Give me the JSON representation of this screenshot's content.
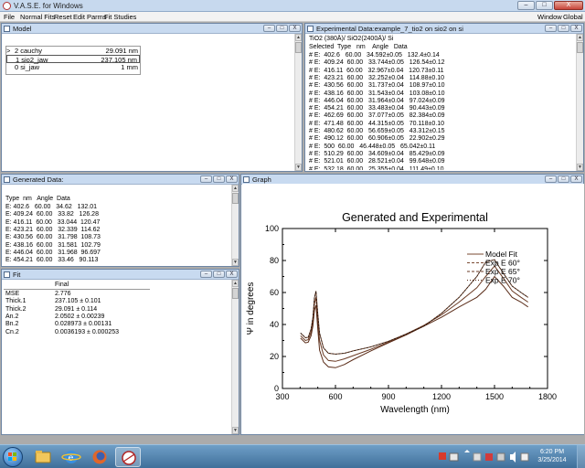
{
  "app": {
    "title": "V.A.S.E. for Windows",
    "window_buttons": {
      "minimize": "–",
      "maximize": "□",
      "close": "X"
    }
  },
  "menu": {
    "left": [
      "File",
      "Normal Fits",
      "Reset",
      "Edit Parms",
      "Fit Studies"
    ],
    "right": [
      "Window",
      "Global"
    ]
  },
  "model_window": {
    "title": "Model",
    "layers": [
      {
        "marker": ">",
        "name": "2 cauchy",
        "value": "29.091 nm",
        "selected": false
      },
      {
        "marker": "",
        "name": "1 sio2_jaw",
        "value": "237.105 nm",
        "selected": true
      },
      {
        "marker": "",
        "name": "0 si_jaw",
        "value": "1 mm",
        "selected": false
      }
    ]
  },
  "exp_window": {
    "title": "Experimental Data:example_7_tio2 on sio2 on si",
    "sample": "TiO2 (380Å)/ SiO2(2400Å)/ Si",
    "header": "Selected  Type   nm    Angle   Data",
    "rows": [
      "# E:  402.6   60.00   34.592±0.05   132.4±0.14",
      "# E:  409.24  60.00   33.744±0.05   126.54±0.12",
      "# E:  416.11  60.00   32.967±0.04   120.73±0.11",
      "# E:  423.21  60.00   32.252±0.04   114.88±0.10",
      "# E:  430.56  60.00   31.737±0.04   108.97±0.10",
      "# E:  438.16  60.00   31.543±0.04   103.08±0.10",
      "# E:  446.04  60.00   31.964±0.04   97.024±0.09",
      "# E:  454.21  60.00   33.483±0.04   90.443±0.09",
      "# E:  462.69  60.00   37.077±0.05   82.384±0.09",
      "# E:  471.48  60.00   44.315±0.05   70.118±0.10",
      "# E:  480.62  60.00   56.659±0.05   43.312±0.15",
      "# E:  490.12  60.00   60.906±0.05   22.902±0.29",
      "# E:  500  60.00   46.448±0.05   65.042±0.11",
      "# E:  510.29  60.00   34.609±0.04   85.429±0.09",
      "# E:  521.01  60.00   28.521±0.04   99.648±0.09",
      "# E:  532.18  60.00   25.355±0.04   111.49±0.10"
    ]
  },
  "gen_window": {
    "title": "Generated Data:",
    "header": "Type  nm   Angle  Data",
    "rows": [
      "E: 402.6   60.00   34.62   132.01",
      "E: 409.24  60.00   33.82   126.28",
      "E: 416.11  60.00   33.044  120.47",
      "E: 423.21  60.00   32.339  114.62",
      "E: 430.56  60.00   31.798  108.73",
      "E: 438.16  60.00   31.581  102.79",
      "E: 446.04  60.00   31.968  96.697",
      "E: 454.21  60.00   33.46   90.113"
    ]
  },
  "fit_window": {
    "title": "Fit",
    "col_header": "Final",
    "rows": [
      {
        "name": "MSE",
        "value": "2.776"
      },
      {
        "name": "Thick.1",
        "value": "237.105 ± 0.101"
      },
      {
        "name": "Thick.2",
        "value": "29.091 ± 0.114"
      },
      {
        "name": "An.2",
        "value": "2.0502 ± 0.00239"
      },
      {
        "name": "Bn.2",
        "value": "0.028973 ± 0.00131"
      },
      {
        "name": "Cn.2",
        "value": "0.0036193 ± 0.000253"
      }
    ]
  },
  "graph_window": {
    "title": "Graph",
    "chart_data": {
      "type": "line",
      "title": "Generated and Experimental",
      "xlabel": "Wavelength (nm)",
      "ylabel": "Ψ in degrees",
      "xlim": [
        300,
        1800
      ],
      "ylim": [
        0,
        100
      ],
      "xticks": [
        300,
        600,
        900,
        1200,
        1500,
        1800
      ],
      "yticks": [
        0,
        20,
        40,
        60,
        80,
        100
      ],
      "grid": false,
      "legend_position": "top-right",
      "legend": [
        "Model Fit",
        "Exp E 60°",
        "Exp E 65°",
        "Exp E 70°"
      ],
      "series": [
        {
          "name": "Exp E 60°",
          "color": "#7a4a32",
          "x": [
            402.6,
            430,
            446,
            462,
            472,
            481,
            490,
            500,
            510,
            532,
            560,
            600,
            650,
            700,
            800,
            900,
            1000,
            1100,
            1200,
            1300,
            1400,
            1450,
            1500,
            1550,
            1600,
            1650,
            1690
          ],
          "y": [
            34.6,
            31.7,
            32.0,
            37.1,
            44.3,
            56.7,
            60.9,
            46.4,
            34.6,
            25.4,
            22.0,
            21.5,
            22.0,
            23.5,
            26.0,
            29.5,
            34.0,
            39.0,
            47.0,
            57.0,
            70.0,
            79.0,
            80.5,
            72.0,
            64.0,
            60.0,
            57.0
          ]
        },
        {
          "name": "Exp E 65°",
          "color": "#6a3a24",
          "x": [
            402.6,
            430,
            446,
            462,
            472,
            481,
            490,
            500,
            510,
            532,
            560,
            600,
            650,
            700,
            800,
            900,
            1000,
            1100,
            1200,
            1300,
            1400,
            1450,
            1500,
            1550,
            1600,
            1650,
            1690
          ],
          "y": [
            33.0,
            30.0,
            30.5,
            35.0,
            42.0,
            53.0,
            57.0,
            42.0,
            30.0,
            21.0,
            17.5,
            17.0,
            18.5,
            20.5,
            24.5,
            29.0,
            34.0,
            39.5,
            46.0,
            54.0,
            63.0,
            70.0,
            76.5,
            69.0,
            61.0,
            57.0,
            54.0
          ]
        },
        {
          "name": "Exp E 70°",
          "color": "#5a2c18",
          "x": [
            402.6,
            430,
            446,
            462,
            472,
            481,
            490,
            500,
            510,
            532,
            560,
            600,
            650,
            700,
            800,
            900,
            1000,
            1100,
            1200,
            1300,
            1400,
            1450,
            1500,
            1550,
            1600,
            1650,
            1690
          ],
          "y": [
            31.5,
            28.5,
            29.0,
            33.0,
            39.0,
            49.0,
            52.0,
            37.0,
            24.0,
            16.5,
            13.5,
            13.0,
            15.0,
            18.0,
            23.5,
            28.5,
            33.5,
            39.0,
            44.5,
            51.0,
            57.0,
            62.0,
            70.0,
            64.0,
            57.0,
            54.0,
            51.0
          ]
        },
        {
          "name": "Model Fit",
          "color": "#000000",
          "x": [
            402.6,
            430,
            446,
            462,
            472,
            481,
            490,
            500,
            510,
            532,
            560,
            600,
            650,
            700,
            800,
            900,
            1000,
            1100,
            1200,
            1300,
            1400,
            1450,
            1500,
            1550,
            1600,
            1650,
            1690
          ],
          "y": [
            34.6,
            31.8,
            32.0,
            37.0,
            44.3,
            56.6,
            60.8,
            46.5,
            34.6,
            25.4,
            22.0,
            21.5,
            22.0,
            23.5,
            26.0,
            29.5,
            34.0,
            39.0,
            47.0,
            57.0,
            70.0,
            79.0,
            80.5,
            72.0,
            64.0,
            60.0,
            57.0
          ]
        }
      ]
    }
  },
  "taskbar": {
    "clock_time": "6:20 PM",
    "clock_date": "3/25/2014",
    "pinned": [
      "windows-explorer-icon",
      "internet-explorer-icon",
      "firefox-icon",
      "vase-app-icon"
    ]
  }
}
